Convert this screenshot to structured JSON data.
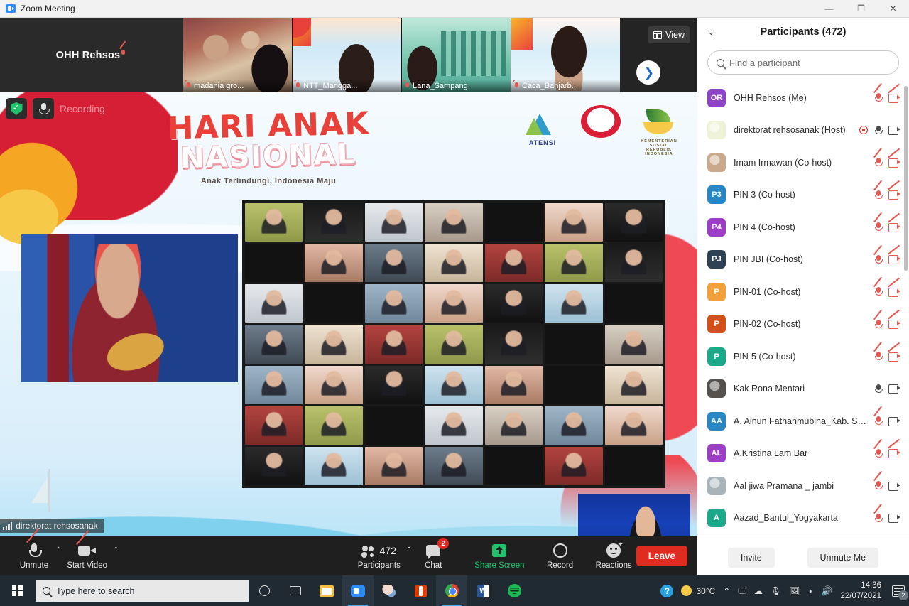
{
  "window": {
    "title": "Zoom Meeting",
    "app_icon": "zoom-video-icon",
    "minimize": "—",
    "restore": "❐",
    "close": "✕"
  },
  "filmstrip": {
    "self_name": "OHH Rehsos",
    "view_label": "View",
    "view_icon": "grid-view-icon",
    "next_icon": "chevron-right-icon",
    "thumbnails": [
      {
        "label": "madania gro...",
        "muted": true,
        "art": "art1"
      },
      {
        "label": "NTT_Mangga...",
        "muted": true,
        "art": "art2"
      },
      {
        "label": "Lana_Sampang",
        "muted": true,
        "art": "art3"
      },
      {
        "label": "Caca_Banjarb...",
        "muted": true,
        "art": "art4"
      }
    ]
  },
  "slide": {
    "title_line1": "HARI ANAK",
    "title_line2": "NASIONAL",
    "tagline": "Anak Terlindungi, Indonesia Maju",
    "logos": [
      {
        "name": "ATENSI",
        "caption": "ATENSI"
      },
      {
        "name": "hari-anak-nasional-seal",
        "caption": ""
      },
      {
        "name": "kementerian-sosial",
        "caption": "KEMENTERIAN SOSIAL REPUBLIK INDONESIA"
      }
    ],
    "recording_label": "Recording",
    "security_icon": "shield-check-icon",
    "mic_icon": "microphone-icon",
    "active_speaker_name": "direktorat rehsosanak",
    "gallery_tiles": 49
  },
  "controls": {
    "mic": {
      "label": "Unmute",
      "icon": "microphone-off-icon",
      "caret": "⌃"
    },
    "video": {
      "label": "Start Video",
      "icon": "camera-off-icon",
      "caret": "⌃"
    },
    "participants": {
      "label": "Participants",
      "count": "472",
      "icon": "people-icon",
      "caret": "⌃"
    },
    "chat": {
      "label": "Chat",
      "icon": "chat-bubble-icon",
      "badge": "2"
    },
    "share": {
      "label": "Share Screen",
      "icon": "share-screen-icon"
    },
    "record": {
      "label": "Record",
      "icon": "record-circle-icon"
    },
    "reactions": {
      "label": "Reactions",
      "icon": "reactions-smiley-icon"
    },
    "leave": {
      "label": "Leave"
    }
  },
  "panel": {
    "collapse_icon": "chevron-down-icon",
    "title": "Participants (472)",
    "search_placeholder": "Find a participant",
    "search_value": "",
    "search_icon": "search-icon",
    "invite_label": "Invite",
    "unmute_me_label": "Unmute Me",
    "participants": [
      {
        "name": "OHH Rehsos (Me)",
        "initials": "OR",
        "color": "#8e44c9",
        "photo": false,
        "mic": "off",
        "cam": "off",
        "recording": false
      },
      {
        "name": "direktorat rehsosanak (Host)",
        "initials": "",
        "color": "#eef3d8",
        "photo": true,
        "mic": "on",
        "cam": "on",
        "recording": true
      },
      {
        "name": "Imam Irmawan (Co-host)",
        "initials": "",
        "color": "#c9a98a",
        "photo": true,
        "mic": "off",
        "cam": "off",
        "recording": false
      },
      {
        "name": "PIN 3 (Co-host)",
        "initials": "P3",
        "color": "#2986c4",
        "photo": false,
        "mic": "off",
        "cam": "off",
        "recording": false
      },
      {
        "name": "PIN 4 (Co-host)",
        "initials": "P4",
        "color": "#9c3fc4",
        "photo": false,
        "mic": "off",
        "cam": "off",
        "recording": false
      },
      {
        "name": "PIN JBI (Co-host)",
        "initials": "PJ",
        "color": "#2f4254",
        "photo": false,
        "mic": "off",
        "cam": "off",
        "recording": false
      },
      {
        "name": "PIN-01 (Co-host)",
        "initials": "P",
        "color": "#f2a13a",
        "photo": false,
        "mic": "off",
        "cam": "off",
        "recording": false
      },
      {
        "name": "PIN-02 (Co-host)",
        "initials": "P",
        "color": "#d4501b",
        "photo": false,
        "mic": "off",
        "cam": "off",
        "recording": false
      },
      {
        "name": "PIN-5 (Co-host)",
        "initials": "P",
        "color": "#1ba98a",
        "photo": false,
        "mic": "off",
        "cam": "off",
        "recording": false
      },
      {
        "name": "Kak Rona Mentari",
        "initials": "",
        "color": "#55514e",
        "photo": true,
        "mic": "on",
        "cam": "on",
        "recording": false
      },
      {
        "name": "A. Ainun Fathanmubina_Kab. Sa...",
        "initials": "AA",
        "color": "#2986c4",
        "photo": false,
        "mic": "off",
        "cam": "on",
        "recording": false
      },
      {
        "name": "A.Kristina Lam Bar",
        "initials": "AL",
        "color": "#9c3fc4",
        "photo": false,
        "mic": "off",
        "cam": "off",
        "recording": false
      },
      {
        "name": "Aal jiwa Pramana _ jambi",
        "initials": "",
        "color": "#a8b3ba",
        "photo": true,
        "mic": "off",
        "cam": "on",
        "recording": false
      },
      {
        "name": "Aazad_Bantul_Yogyakarta",
        "initials": "A",
        "color": "#1ba98a",
        "photo": false,
        "mic": "off",
        "cam": "on",
        "recording": false
      }
    ]
  },
  "taskbar": {
    "start_icon": "windows-logo-icon",
    "search_placeholder": "Type here to search",
    "cortana_icon": "cortana-circle-icon",
    "taskview_icon": "task-view-icon",
    "apps": [
      {
        "name": "file-explorer",
        "icon": "folder-icon",
        "active": false
      },
      {
        "name": "zoom",
        "icon": "zoom-icon",
        "active": true
      },
      {
        "name": "paint",
        "icon": "paint-icon",
        "active": false
      },
      {
        "name": "office",
        "icon": "office-icon",
        "active": false
      },
      {
        "name": "chrome",
        "icon": "chrome-icon",
        "active": true
      },
      {
        "name": "word",
        "icon": "word-icon",
        "active": false
      },
      {
        "name": "spotify",
        "icon": "spotify-icon",
        "active": false
      }
    ],
    "tray": {
      "help_icon": "help-circle-icon",
      "weather_icon": "sun-icon",
      "temperature": "30°C",
      "overflow_caret": "⌃",
      "zoom_tray_icon": "zoom-tray-icon",
      "onedrive_icon": "onedrive-icon",
      "mic_tray_icon": "microphone-tray-icon",
      "display_icon": "display-icon",
      "network_icon": "wifi-icon",
      "volume_icon": "speaker-icon",
      "time": "14:36",
      "date": "22/07/2021",
      "notification_icon": "action-center-icon",
      "notification_count": "2"
    }
  }
}
